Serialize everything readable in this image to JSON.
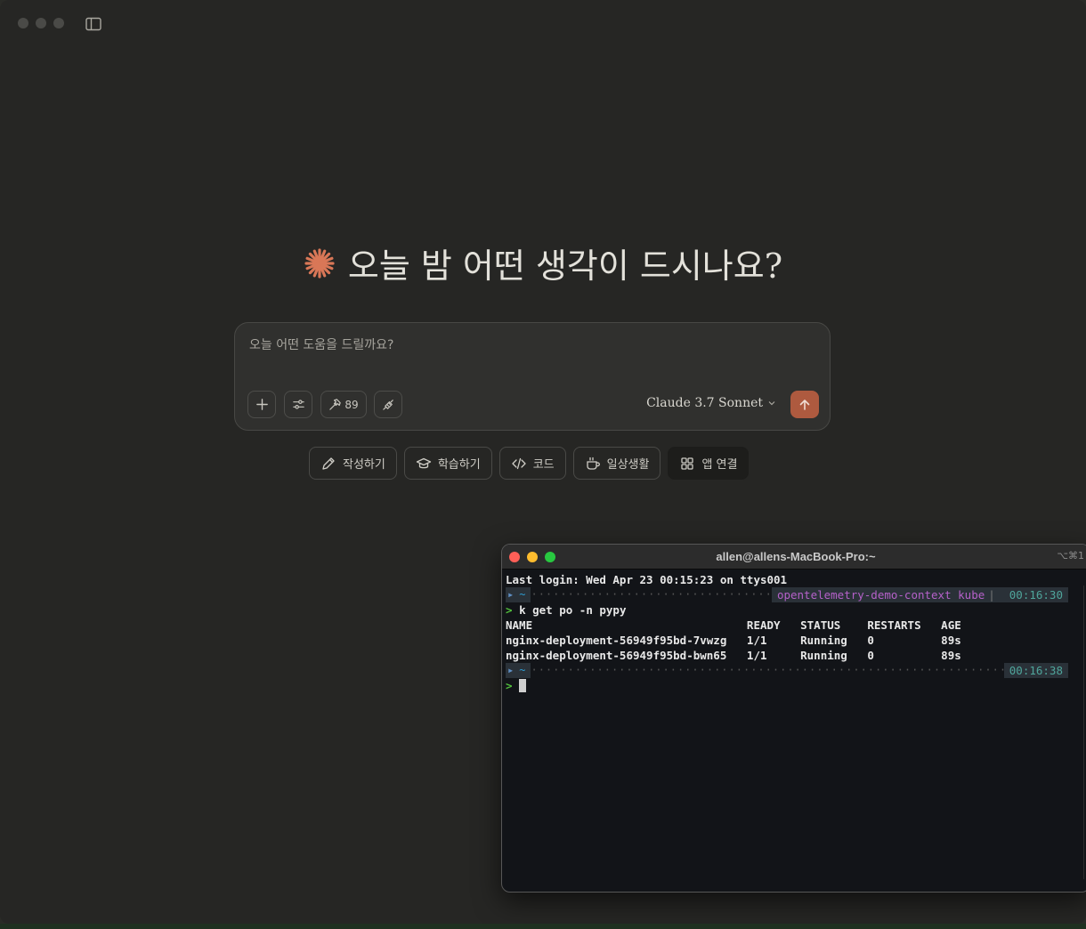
{
  "app": {
    "greeting": "오늘 밤 어떤 생각이 드시나요?",
    "accent": "#d97757",
    "prompt_placeholder": "오늘 어떤 도움을 드릴까요?",
    "tools_count": "89",
    "model": "Claude 3.7 Sonnet",
    "chips": [
      "작성하기",
      "학습하기",
      "코드",
      "일상생활",
      "앱 연결"
    ]
  },
  "terminal": {
    "title": "allen@allens-MacBook-Pro:~",
    "shortcut": "⌥⌘1",
    "last_login": "Last login: Wed Apr 23 00:15:23 on ttys001",
    "prompt_dir": "~",
    "context": "opentelemetry-demo-context",
    "context_suffix": "kube",
    "time1": "00:16:30",
    "command": "k get po -n pypy",
    "header": "NAME                                READY   STATUS    RESTARTS   AGE",
    "rows": [
      "nginx-deployment-56949f95bd-7vwzg   1/1     Running   0          89s",
      "nginx-deployment-56949f95bd-bwn65   1/1     Running   0          89s"
    ],
    "time2": "00:16:38",
    "caret": ">"
  }
}
